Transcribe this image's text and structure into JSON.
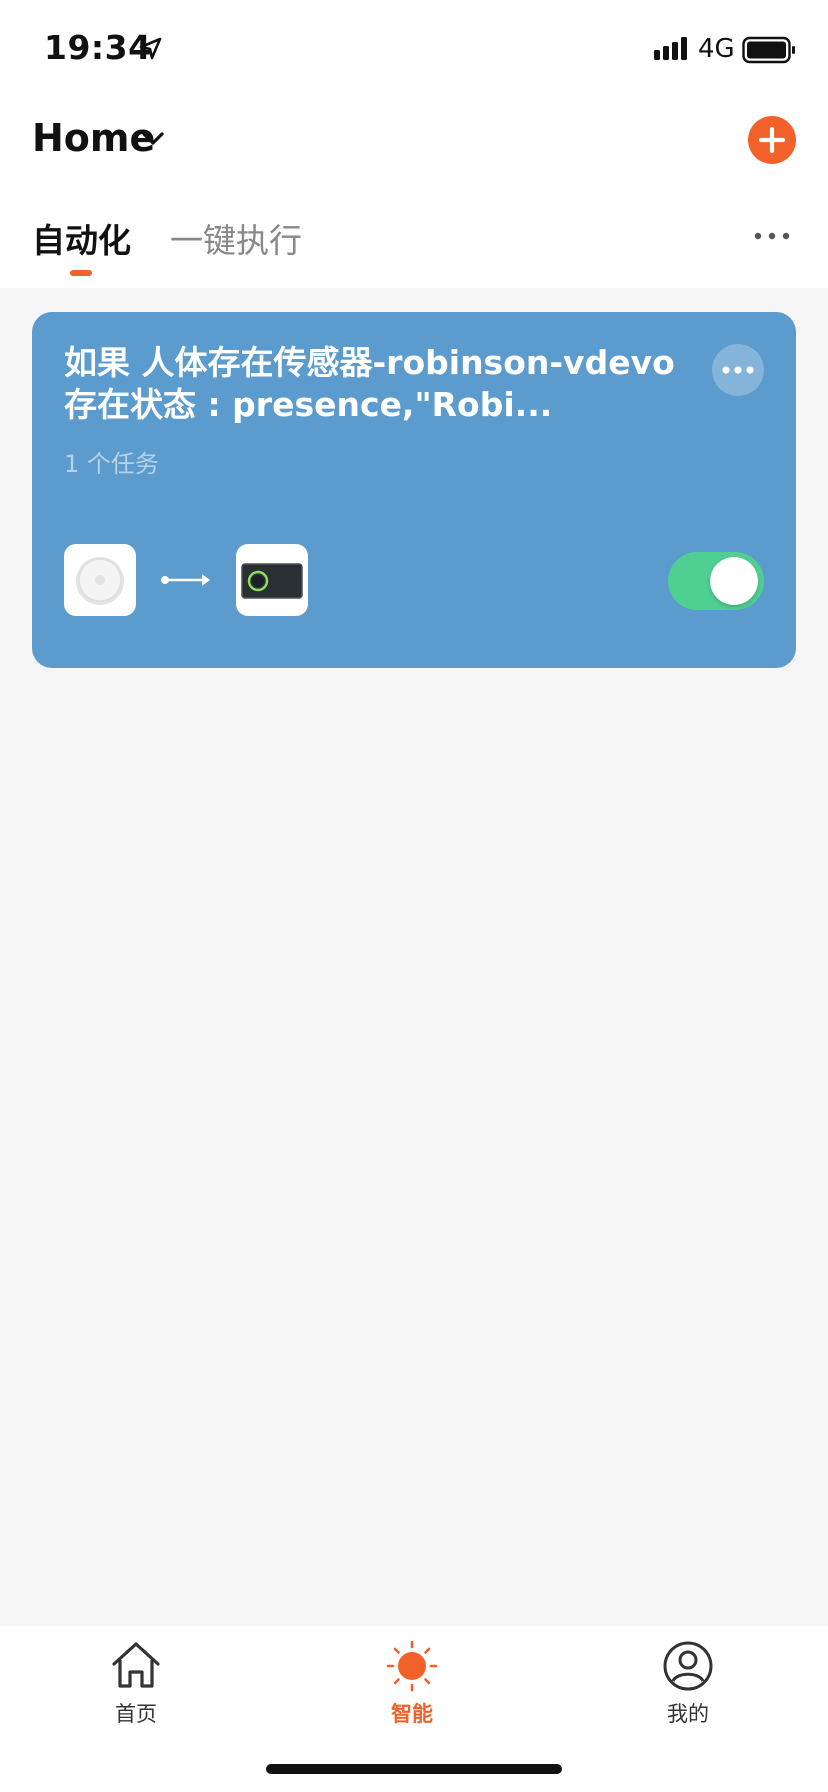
{
  "status_bar": {
    "time": "19:34",
    "network": "4G",
    "icons": [
      "location-arrow-icon",
      "signal-bars-icon",
      "battery-icon"
    ]
  },
  "header": {
    "title": "Home",
    "dropdown_icon": "chevron-down-icon",
    "add_icon": "plus-icon"
  },
  "tabs": {
    "items": [
      {
        "label": "自动化",
        "active": true
      },
      {
        "label": "一键执行",
        "active": false
      }
    ],
    "more_icon": "more-dots-icon"
  },
  "automation_card": {
    "title": "如果 人体存在传感器-robinson-vdevo 存在状态 : presence,\"Robi...",
    "tasks": "1 个任务",
    "enabled": true,
    "trigger_device_icon": "presence-sensor-icon",
    "action_device_icon": "control-panel-icon",
    "background_color": "#5b9bcd",
    "toggle_color": "#4fcf92"
  },
  "bottom_nav": {
    "items": [
      {
        "label": "首页",
        "icon": "house-icon",
        "active": false
      },
      {
        "label": "智能",
        "icon": "sun-icon",
        "active": true
      },
      {
        "label": "我的",
        "icon": "user-circle-icon",
        "active": false
      }
    ],
    "active_color": "#f2612a"
  }
}
